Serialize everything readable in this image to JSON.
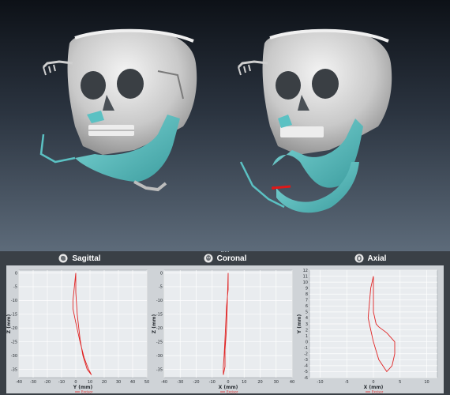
{
  "viewer": {
    "left_skull": "preoperative-skull-model",
    "right_skull": "postoperative-skull-model",
    "colors": {
      "bone": "#d6d6d6",
      "mandible": "#5bc1c3",
      "marker": "#e01818"
    }
  },
  "panels": [
    {
      "title": "Sagittal",
      "icon": "head-sagittal-icon",
      "xlabel": "Y (mm)",
      "ylabel": "Z (mm)",
      "xticks": [
        "-40",
        "-30",
        "-20",
        "-10",
        "0",
        "10",
        "20",
        "30",
        "40",
        "50"
      ],
      "yticks": [
        "0",
        "-5",
        "-10",
        "-15",
        "-20",
        "-25",
        "-30",
        "-35"
      ],
      "legend": "Excisor"
    },
    {
      "title": "Coronal",
      "icon": "head-coronal-icon",
      "xlabel": "X (mm)",
      "ylabel": "Z (mm)",
      "xticks": [
        "-40",
        "-30",
        "-20",
        "-10",
        "0",
        "10",
        "20",
        "30",
        "40"
      ],
      "yticks": [
        "0",
        "-5",
        "-10",
        "-15",
        "-20",
        "-25",
        "-30",
        "-35"
      ],
      "legend": "Excisor"
    },
    {
      "title": "Axial",
      "icon": "head-axial-icon",
      "xlabel": "X (mm)",
      "ylabel": "Y (mm)",
      "xticks": [
        "-10",
        "-5",
        "0",
        "5",
        "10"
      ],
      "yticks": [
        "12",
        "11",
        "10",
        "9",
        "8",
        "7",
        "6",
        "5",
        "4",
        "3",
        "2",
        "1",
        "0",
        "-1",
        "-2",
        "-3",
        "-4",
        "-5",
        "-6"
      ],
      "legend": "Excisor"
    }
  ],
  "chart_data": [
    {
      "type": "line",
      "title": "Sagittal",
      "xlabel": "Y (mm)",
      "ylabel": "Z (mm)",
      "xlim": [
        -40,
        50
      ],
      "ylim": [
        -38,
        1
      ],
      "grid": true,
      "legend": "bottom-center",
      "series": [
        {
          "name": "Excisor",
          "x": [
            0,
            -1,
            -2,
            -2,
            0,
            3,
            6,
            9,
            11,
            8,
            5,
            3,
            1,
            0,
            0
          ],
          "y": [
            0,
            -5,
            -10,
            -13,
            -18,
            -25,
            -31,
            -35,
            -37,
            -35,
            -30,
            -24,
            -15,
            -7,
            0
          ]
        }
      ]
    },
    {
      "type": "line",
      "title": "Coronal",
      "xlabel": "X (mm)",
      "ylabel": "Z (mm)",
      "xlim": [
        -40,
        40
      ],
      "ylim": [
        -38,
        1
      ],
      "grid": true,
      "legend": "bottom-center",
      "series": [
        {
          "name": "Excisor",
          "x": [
            0,
            0,
            -1,
            -1.5,
            -2,
            -2.5,
            -3,
            -3,
            -2,
            -2,
            -1,
            -0.5,
            0
          ],
          "y": [
            0,
            -6,
            -12,
            -18,
            -24,
            -30,
            -34,
            -37,
            -34,
            -28,
            -20,
            -10,
            0
          ]
        }
      ]
    },
    {
      "type": "line",
      "title": "Axial",
      "xlabel": "X (mm)",
      "ylabel": "Y (mm)",
      "xlim": [
        -12,
        12
      ],
      "ylim": [
        -6,
        12
      ],
      "grid": true,
      "legend": "bottom-center",
      "series": [
        {
          "name": "Excisor",
          "x": [
            0,
            0,
            0,
            0.5,
            1,
            2.5,
            4,
            4,
            3.5,
            2.5,
            1,
            0,
            -0.5,
            -1,
            -0.8,
            -0.5,
            0
          ],
          "y": [
            11,
            8,
            5,
            3,
            2.5,
            1.5,
            0,
            -2,
            -4,
            -5,
            -3,
            0,
            2,
            4,
            6,
            9,
            11
          ]
        }
      ]
    }
  ]
}
